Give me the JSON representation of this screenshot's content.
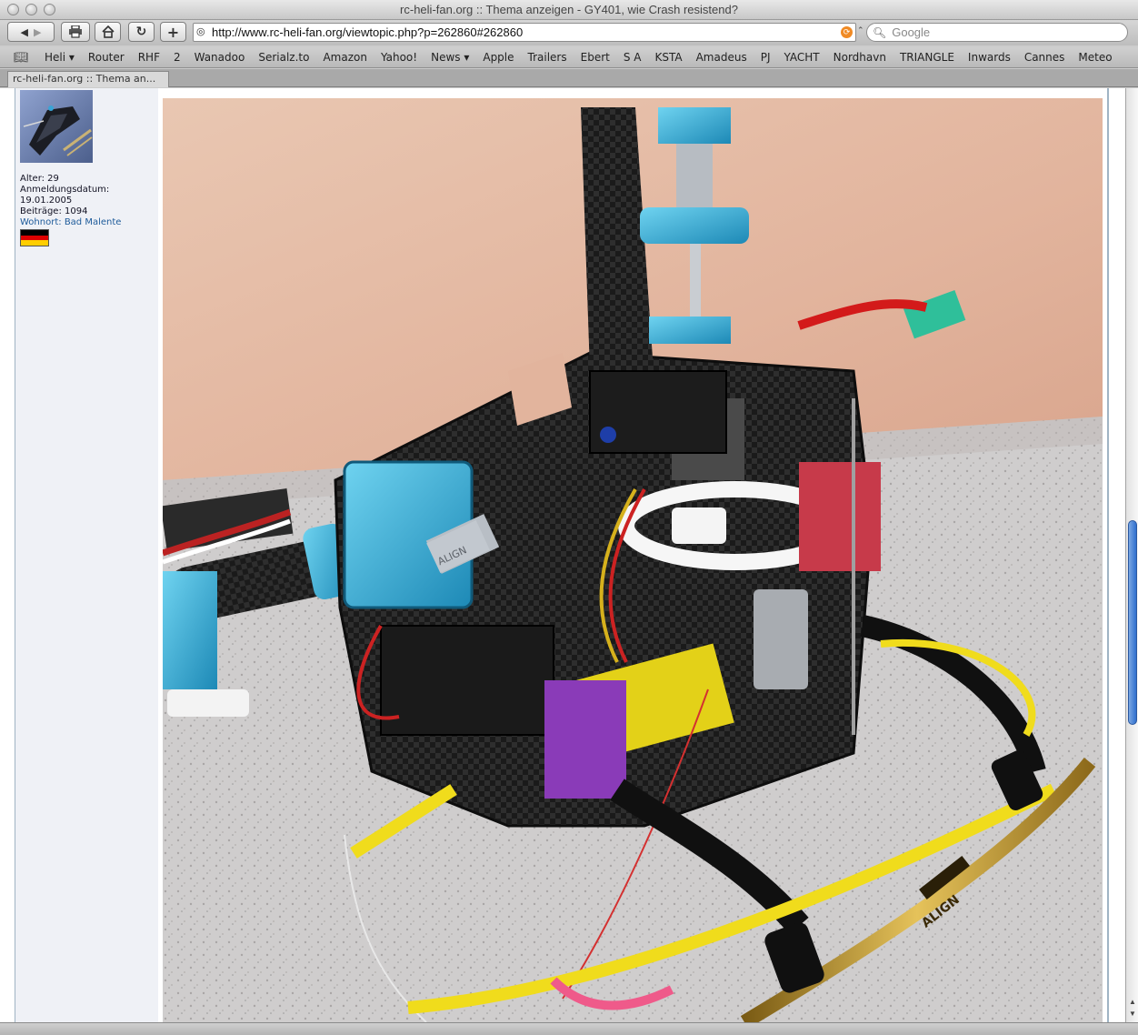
{
  "window": {
    "title": "rc-heli-fan.org :: Thema anzeigen - GY401, wie Crash resistend?"
  },
  "toolbar": {
    "back_icon": "back-arrow-icon",
    "forward_icon": "forward-arrow-icon",
    "print_icon": "printer-icon",
    "home_icon": "home-icon",
    "reload_icon": "reload-icon",
    "add_icon": "plus-icon",
    "url": "http://www.rc-heli-fan.org/viewtopic.php?p=262860#262860",
    "search_placeholder": "Google"
  },
  "bookmarks": [
    "Heli ▾",
    "Router",
    "RHF",
    "2",
    "Wanadoo",
    "Serialz.to",
    "Amazon",
    "Yahoo!",
    "News ▾",
    "Apple",
    "Trailers",
    "Ebert",
    "S A",
    "KSTA",
    "Amadeus",
    "PJ",
    "YACHT",
    "Nordhavn",
    "TRIANGLE",
    "Inwards",
    "Cannes",
    "Meteo"
  ],
  "tab": {
    "label": "rc-heli-fan.org :: Thema an..."
  },
  "user": {
    "age_line": "Alter: 29",
    "reg_label": "Anmeldungsdatum:",
    "reg_date": "19.01.2005",
    "posts_line": "Beiträge: 1094",
    "location_label": "Wohnort:",
    "location_value": "Bad Malente"
  },
  "photo": {
    "branding": "ALIGN"
  },
  "colors": {
    "link": "#1e5b9a",
    "scroll_thumb": "#2f6fce",
    "flag_black": "#000000",
    "flag_red": "#dd0000",
    "flag_gold": "#ffce00"
  }
}
